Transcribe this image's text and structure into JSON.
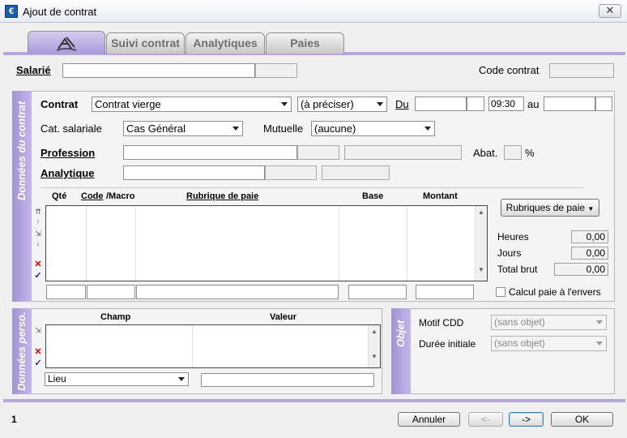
{
  "window": {
    "title": "Ajout de contrat",
    "close_label": "✕"
  },
  "tabs": [
    {
      "label": ""
    },
    {
      "label": "Suivi contrat"
    },
    {
      "label": "Analytiques"
    },
    {
      "label": "Paies"
    }
  ],
  "header": {
    "salarie_label": "Salarié",
    "code_contrat_label": "Code contrat"
  },
  "donnees_contrat": {
    "section_label": "Données du contrat",
    "contrat_label": "Contrat",
    "contrat_value": "Contrat vierge",
    "contrat_type_value": "(à préciser)",
    "du_label": "Du",
    "time_value": "09:30",
    "au_label": "au",
    "cat_label": "Cat. salariale",
    "cat_value": "Cas Général",
    "mutuelle_label": "Mutuelle",
    "mutuelle_value": "(aucune)",
    "profession_label": "Profession",
    "abat_label": "Abat.",
    "percent": "%",
    "analytique_label": "Analytique"
  },
  "rubriques_table": {
    "headers": {
      "qte": "Qté",
      "code": "Code",
      "macro": "/Macro",
      "rubrique": "Rubrique de paie",
      "base": "Base",
      "montant": "Montant"
    },
    "rubriques_button": "Rubriques de paie",
    "heures_label": "Heures",
    "heures_value": "0,00",
    "jours_label": "Jours",
    "jours_value": "0,00",
    "total_label": "Total brut",
    "total_value": "0,00",
    "calcul_label": "Calcul paie à l'envers"
  },
  "donnees_perso": {
    "section_label": "Données perso.",
    "champ_header": "Champ",
    "valeur_header": "Valeur",
    "lieu_value": "Lieu"
  },
  "objet": {
    "section_label": "Objet",
    "motif_label": "Motif CDD",
    "motif_value": "(sans objet)",
    "duree_label": "Durée initiale",
    "duree_value": "(sans objet)"
  },
  "footer": {
    "page_number": "1",
    "annuler": "Annuler",
    "prev": "<-",
    "next": "->",
    "ok": "OK"
  },
  "colors": {
    "accent": "#b7a9de",
    "section": "#a194d2"
  }
}
